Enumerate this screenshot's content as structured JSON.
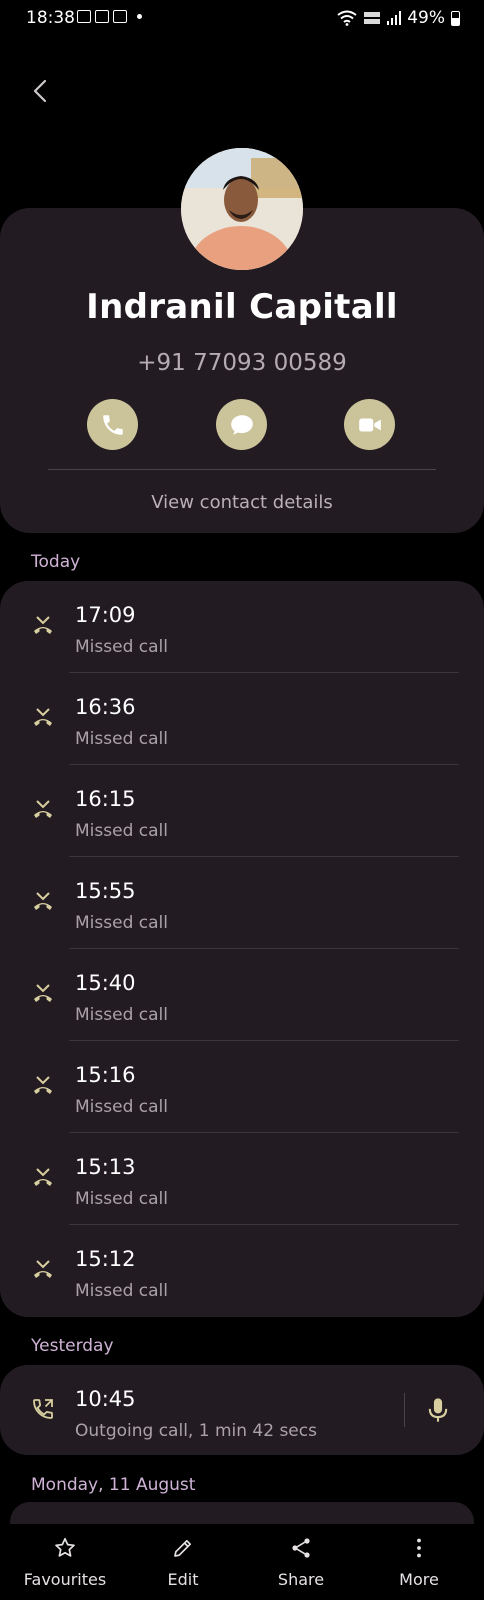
{
  "status_bar": {
    "time": "18:38",
    "battery_text": "49%",
    "icons": [
      "gallery-icon",
      "teams-icon",
      "news-icon",
      "dot-icon",
      "wifi-icon",
      "volte-icon",
      "signal-icon",
      "battery-icon"
    ]
  },
  "contact": {
    "name": "Indranil Capitall",
    "phone": "+91 77093 00589",
    "view_details_label": "View contact details",
    "actions": [
      "phone-icon",
      "message-icon",
      "video-icon"
    ]
  },
  "sections": {
    "today": {
      "label": "Today",
      "calls": [
        {
          "time": "17:09",
          "type": "Missed call"
        },
        {
          "time": "16:36",
          "type": "Missed call"
        },
        {
          "time": "16:15",
          "type": "Missed call"
        },
        {
          "time": "15:55",
          "type": "Missed call"
        },
        {
          "time": "15:40",
          "type": "Missed call"
        },
        {
          "time": "15:16",
          "type": "Missed call"
        },
        {
          "time": "15:13",
          "type": "Missed call"
        },
        {
          "time": "15:12",
          "type": "Missed call"
        }
      ]
    },
    "yesterday": {
      "label": "Yesterday",
      "calls": [
        {
          "time": "10:45",
          "type": "Outgoing call, 1 min 42 secs"
        }
      ]
    },
    "monday": {
      "label": "Monday, 11 August"
    }
  },
  "bottom_nav": {
    "favourites": "Favourites",
    "edit": "Edit",
    "share": "Share",
    "more": "More"
  },
  "colors": {
    "background": "#000000",
    "card": "#231b22",
    "accent_button": "#cbc49a",
    "section_header": "#cfb3d6",
    "secondary_text": "#a9a2a7"
  }
}
